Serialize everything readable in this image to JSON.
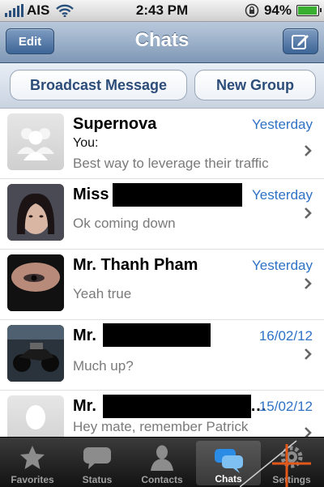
{
  "status_bar": {
    "carrier": "AIS",
    "time": "2:43 PM",
    "battery": "94%",
    "battery_level": 0.94
  },
  "nav": {
    "title": "Chats",
    "edit_label": "Edit",
    "compose_icon": "compose-icon"
  },
  "actions": {
    "broadcast_label": "Broadcast Message",
    "new_group_label": "New Group"
  },
  "chats": [
    {
      "name": "Supernova",
      "date": "Yesterday",
      "sender": "You:",
      "preview": "Best way to leverage their traffic",
      "avatar": "group-avatar-placeholder"
    },
    {
      "name": "Miss",
      "date": "Yesterday",
      "preview": "Ok coming down",
      "avatar": "profile-photo"
    },
    {
      "name": "Mr. Thanh Pham",
      "date": "Yesterday",
      "preview": "Yeah true",
      "avatar": "profile-photo"
    },
    {
      "name": "Mr.",
      "date": "16/02/12",
      "preview": "Much up?",
      "avatar": "motorcycle-photo"
    },
    {
      "name": "Mr.",
      "name_suffix": "…",
      "date": "15/02/12",
      "preview": "Hey mate, remember Patrick",
      "avatar": "person-avatar-placeholder"
    }
  ],
  "tabs": [
    {
      "label": "Favorites",
      "icon": "star-icon",
      "active": false
    },
    {
      "label": "Status",
      "icon": "speech-bubble-icon",
      "active": false
    },
    {
      "label": "Contacts",
      "icon": "person-icon",
      "active": false
    },
    {
      "label": "Chats",
      "icon": "chat-bubbles-icon",
      "active": true
    },
    {
      "label": "Settings",
      "icon": "gear-icon",
      "active": false
    }
  ],
  "colors": {
    "accent_blue": "#2e72c6",
    "nav_button": "#3d6596",
    "tab_bar": "#1e1e1e"
  }
}
